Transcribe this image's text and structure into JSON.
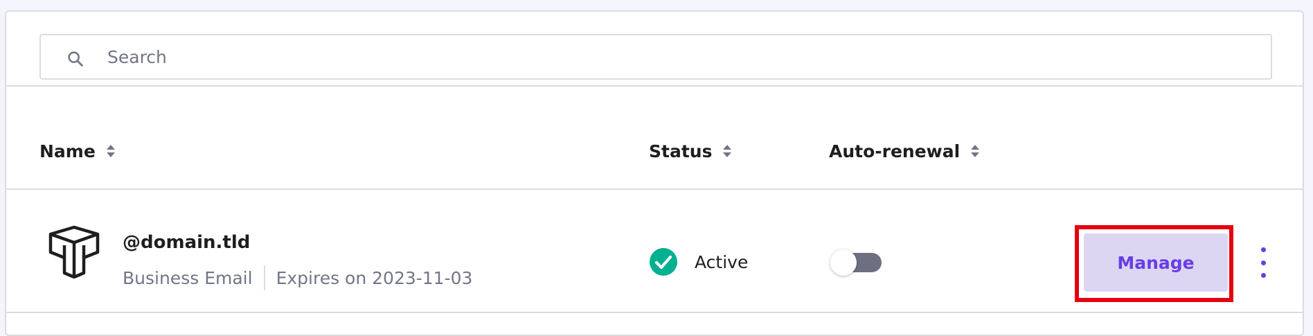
{
  "search": {
    "placeholder": "Search"
  },
  "table": {
    "columns": [
      {
        "label": "Name",
        "sortable": true
      },
      {
        "label": "Status",
        "sortable": true
      },
      {
        "label": "Auto-renewal",
        "sortable": true
      }
    ],
    "rows": [
      {
        "icon": "domain-icon",
        "domain": "@domain.tld",
        "product": "Business Email",
        "expires": "Expires on 2023-11-03",
        "status": "Active",
        "status_icon": "check-circle-icon",
        "auto_renewal": false,
        "action_label": "Manage",
        "more_icon": "more-vertical-icon"
      }
    ]
  },
  "colors": {
    "accent": "#673de6",
    "accent_bg": "#dcd6f2",
    "success": "#00b090",
    "highlight": "#e6000f",
    "muted_text": "#727586",
    "border": "#dadce0",
    "toggle_off": "#6d7081"
  }
}
